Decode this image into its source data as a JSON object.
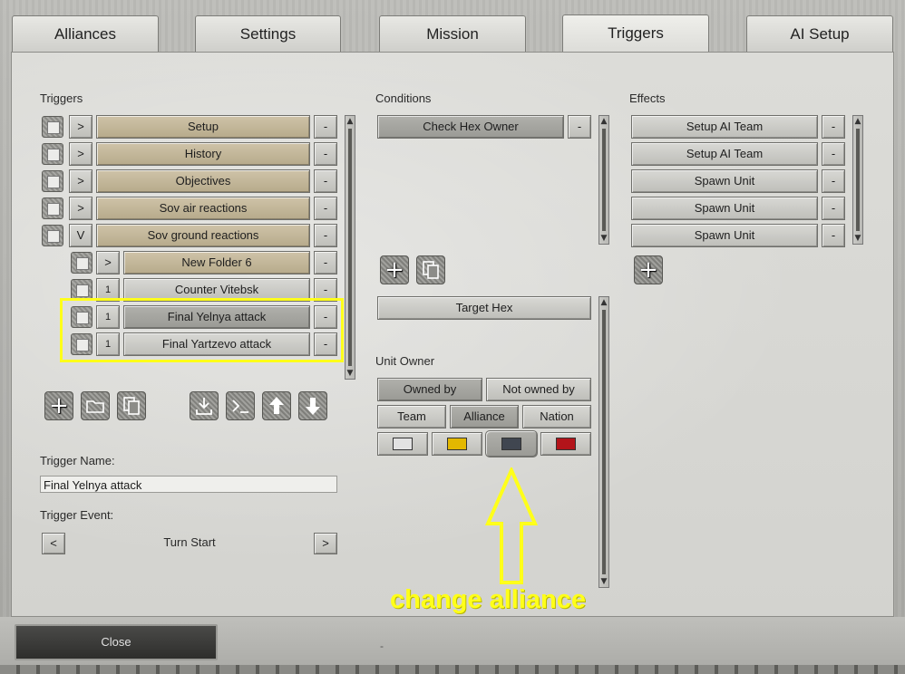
{
  "tabs": [
    "Alliances",
    "Settings",
    "Mission",
    "Triggers",
    "AI Setup"
  ],
  "triggers": {
    "heading": "Triggers",
    "rows": [
      {
        "toggle": ">",
        "label": "Setup",
        "minus": "-"
      },
      {
        "toggle": ">",
        "label": "History",
        "minus": "-"
      },
      {
        "toggle": ">",
        "label": "Objectives",
        "minus": "-"
      },
      {
        "toggle": ">",
        "label": "Sov air reactions",
        "minus": "-"
      },
      {
        "toggle": "V",
        "label": "Sov ground reactions",
        "minus": "-"
      },
      {
        "toggle": ">",
        "label": "New Folder 6",
        "minus": "-"
      },
      {
        "toggle": "1",
        "label": "Counter Vitebsk",
        "minus": "-"
      },
      {
        "toggle": "1",
        "label": "Final Yelnya attack",
        "minus": "-"
      },
      {
        "toggle": "1",
        "label": "Final Yartzevo attack",
        "minus": "-"
      }
    ],
    "name_label": "Trigger Name:",
    "name_value": "Final Yelnya attack",
    "event_label": "Trigger Event:",
    "event_prev": "<",
    "event_value": "Turn Start",
    "event_next": ">"
  },
  "conditions": {
    "heading": "Conditions",
    "items": [
      {
        "label": "Check Hex Owner",
        "minus": "-"
      }
    ],
    "target_hex": "Target Hex",
    "unit_owner_label": "Unit Owner",
    "owned_by": "Owned by",
    "not_owned_by": "Not owned by",
    "team": "Team",
    "alliance": "Alliance",
    "nation": "Nation",
    "swatch_colors": [
      "#e2e2e2",
      "#e3b800",
      "#404650",
      "#b3141a"
    ]
  },
  "effects": {
    "heading": "Effects",
    "items": [
      {
        "label": "Setup AI Team",
        "minus": "-"
      },
      {
        "label": "Setup AI Team",
        "minus": "-"
      },
      {
        "label": "Spawn Unit",
        "minus": "-"
      },
      {
        "label": "Spawn Unit",
        "minus": "-"
      },
      {
        "label": "Spawn Unit",
        "minus": "-"
      }
    ]
  },
  "annotation": "change alliance",
  "footer": {
    "close": "Close",
    "dash": "-"
  }
}
